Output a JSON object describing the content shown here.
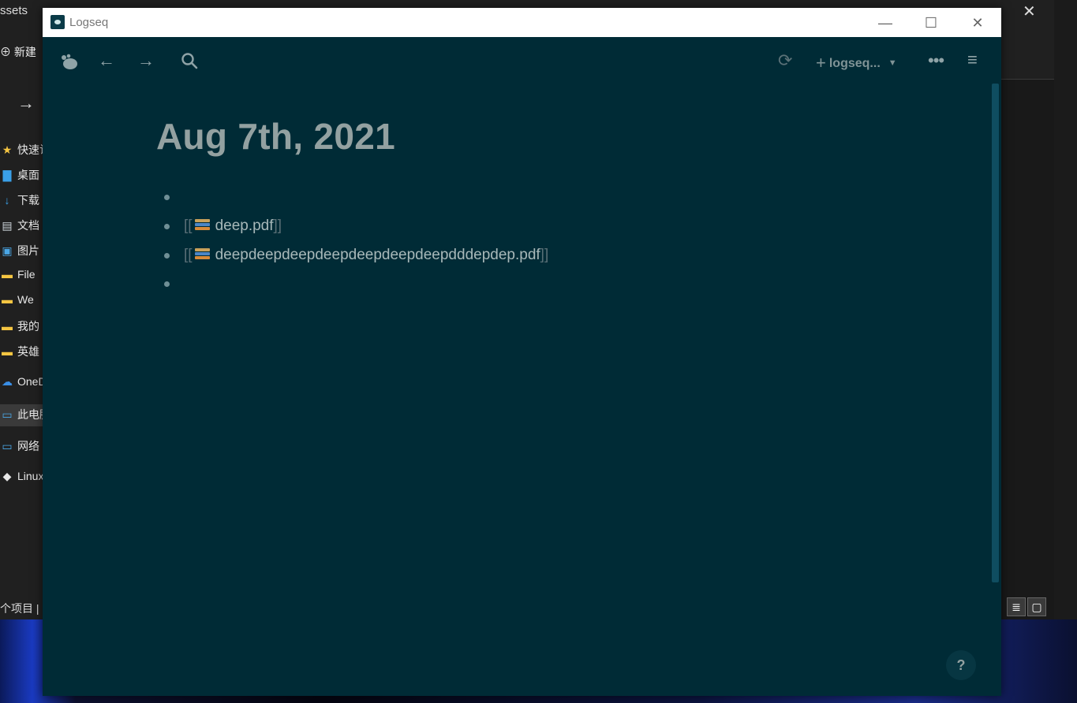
{
  "explorer": {
    "title_fragment": "ssets",
    "new_label": "新建",
    "nav": [
      {
        "icon": "★",
        "label": "快速访",
        "color": "#f5c542"
      },
      {
        "icon": "▇",
        "label": "桌面",
        "color": "#3aa0e8"
      },
      {
        "icon": "↓",
        "label": "下载",
        "color": "#3aa0e8"
      },
      {
        "icon": "▤",
        "label": "文档",
        "color": "#cfd6dc"
      },
      {
        "icon": "▣",
        "label": "图片",
        "color": "#4aa7e6"
      },
      {
        "icon": "▬",
        "label": "File",
        "color": "#f5c542"
      },
      {
        "icon": "▬",
        "label": "We",
        "color": "#f5c542"
      },
      {
        "icon": "▬",
        "label": "我的",
        "color": "#f5c542"
      },
      {
        "icon": "▬",
        "label": "英雄",
        "color": "#f5c542"
      },
      {
        "icon": "☁",
        "label": "OneD",
        "color": "#3a8ee6"
      },
      {
        "icon": "▭",
        "label": "此电脑",
        "color": "#4aa7e6"
      },
      {
        "icon": "▭",
        "label": "网络",
        "color": "#4aa7e6"
      },
      {
        "icon": "◆",
        "label": "Linux",
        "color": "#e8e8e8"
      }
    ],
    "status_text": "个项目  |"
  },
  "logseq": {
    "window_title": "Logseq",
    "repo_name": "logseq...",
    "page_title": "Aug 7th, 2021",
    "blocks": [
      {
        "text": "",
        "has_link": false
      },
      {
        "text": "deep.pdf",
        "has_link": true,
        "open": "[[",
        "close": "]]"
      },
      {
        "text": "deepdeepdeepdeepdeepdeepdeepdddepdep.pdf",
        "has_link": true,
        "open": "[[",
        "close": "]]"
      },
      {
        "text": "",
        "has_link": false
      }
    ],
    "help_label": "?",
    "colors": {
      "background": "#002b36",
      "text": "#93a1a1",
      "accent": "#0f4d60"
    }
  }
}
